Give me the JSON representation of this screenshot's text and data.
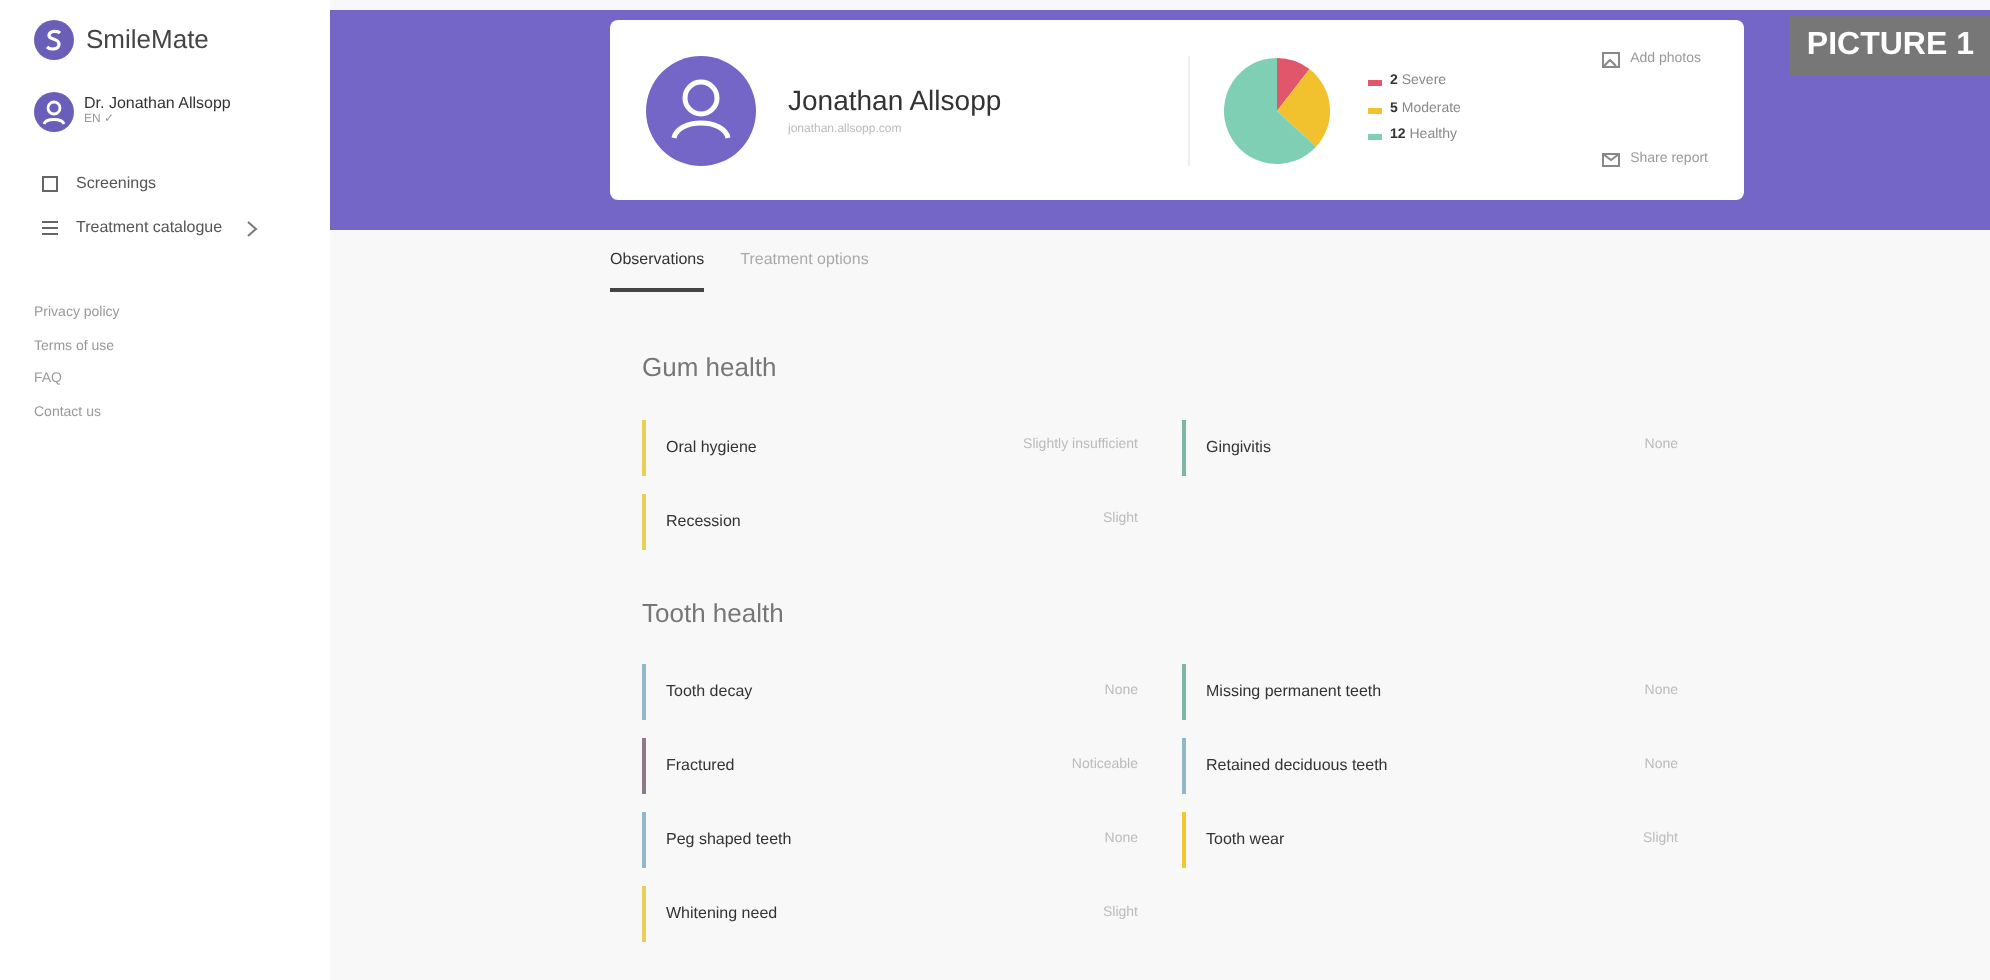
{
  "brand": {
    "name": "SmileMate"
  },
  "user": {
    "name": "Dr. Jonathan Allsopp",
    "subtitle": "EN ✓"
  },
  "nav": [
    {
      "label": "Screenings",
      "kind": "page"
    },
    {
      "label": "Treatment catalogue",
      "kind": "group"
    }
  ],
  "footer_links": [
    "Privacy policy",
    "Terms of use",
    "FAQ",
    "Contact us"
  ],
  "figure_label": "PICTURE 1",
  "patient": {
    "name": "Jonathan Allsopp",
    "subtitle": "jonathan.allsopp.com"
  },
  "summary": {
    "chart_data": {
      "type": "pie",
      "values": [
        10.5,
        26.3,
        63.2
      ]
    },
    "legend": [
      {
        "count": "2",
        "label": "Severe",
        "color": "#e2566c"
      },
      {
        "count": "5",
        "label": "Moderate",
        "color": "#f2c12e"
      },
      {
        "count": "12",
        "label": "Healthy",
        "color": "#7ecfb3"
      }
    ]
  },
  "actions": [
    {
      "label": "Add photos"
    },
    {
      "label": "Share report"
    }
  ],
  "tabs": [
    {
      "label": "Observations",
      "selected": true
    },
    {
      "label": "Treatment options",
      "selected": false
    }
  ],
  "sections": [
    {
      "title": "Gum health",
      "items": [
        {
          "label": "Oral hygiene",
          "value": "Slightly insufficient",
          "color": "#e8cf5a"
        },
        {
          "label": "Gingivitis",
          "value": "None",
          "color": "#7fb5a8"
        },
        {
          "label": "Recession",
          "value": "Slight",
          "color": "#e8cf5a"
        }
      ]
    },
    {
      "title": "Tooth health",
      "items": [
        {
          "label": "Tooth decay",
          "value": "None",
          "color": "#8fb8c8"
        },
        {
          "label": "Missing permanent teeth",
          "value": "None",
          "color": "#7fb5a8"
        },
        {
          "label": "Fractured",
          "value": "Noticeable",
          "color": "#8a7a8a"
        },
        {
          "label": "Retained deciduous teeth",
          "value": "None",
          "color": "#8fb8c8"
        },
        {
          "label": "Peg shaped teeth",
          "value": "None",
          "color": "#8fb8c8"
        },
        {
          "label": "Tooth wear",
          "value": "Slight",
          "color": "#f0c832"
        },
        {
          "label": "Whitening need",
          "value": "Slight",
          "color": "#e8cf5a"
        }
      ]
    }
  ]
}
